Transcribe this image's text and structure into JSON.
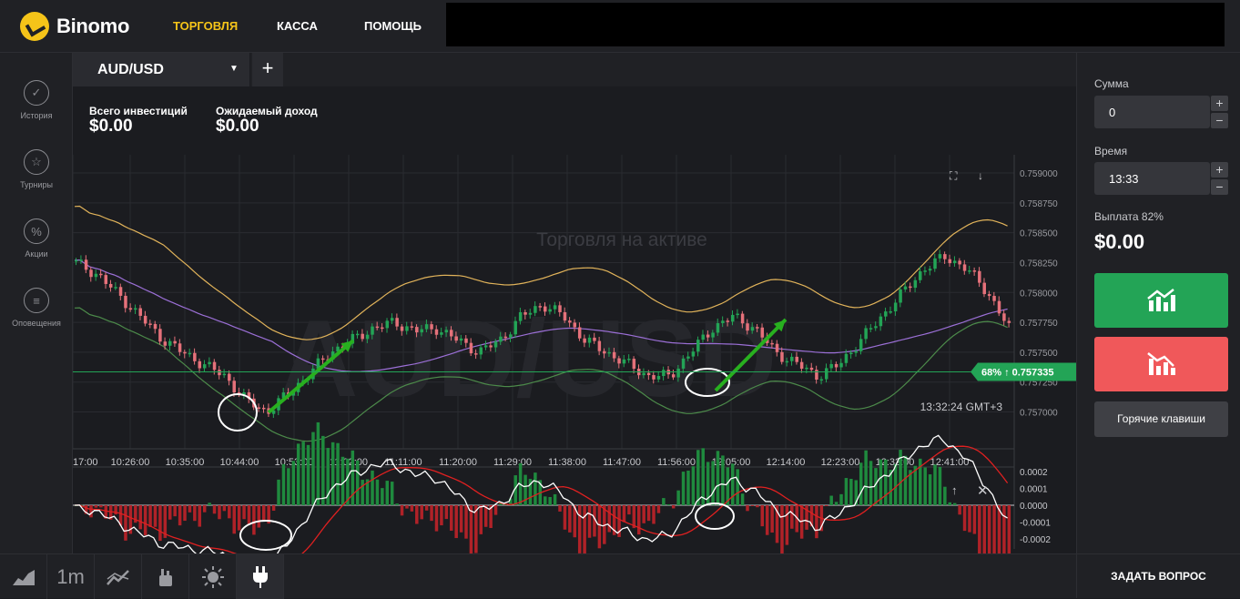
{
  "header": {
    "brand": "Binomo",
    "nav": {
      "trade": "ТОРГОВЛЯ",
      "cash": "КАССА",
      "help": "ПОМОЩЬ"
    }
  },
  "sidebar": {
    "items": [
      {
        "label": "История",
        "icon": "check-circle-icon"
      },
      {
        "label": "Турниры",
        "icon": "trophy-icon"
      },
      {
        "label": "Акции",
        "icon": "percent-icon"
      },
      {
        "label": "Оповещения",
        "icon": "menu-lines-icon"
      }
    ]
  },
  "tabs": {
    "asset": "AUD/USD",
    "add": "+"
  },
  "stats": {
    "invest_label": "Всего инвестиций",
    "invest_value": "$0.00",
    "income_label": "Ожидаемый доход",
    "income_value": "$0.00"
  },
  "chart": {
    "watermark": "AUD/USD",
    "subtitle": "Торговля на активе",
    "price_levels": [
      "0.759000",
      "0.758750",
      "0.758500",
      "0.758250",
      "0.758000",
      "0.757750",
      "0.757500",
      "0.757250",
      "0.757000"
    ],
    "time_ticks": [
      "17:00",
      "10:26:00",
      "10:35:00",
      "10:44:00",
      "10:53:00",
      "11:02:00",
      "11:11:00",
      "11:20:00",
      "11:29:00",
      "11:38:00",
      "11:47:00",
      "11:56:00",
      "12:05:00",
      "12:14:00",
      "12:23:00",
      "12:32:00",
      "12:41:00"
    ],
    "current_badge_pct": "68%",
    "current_badge_arrow": "↑",
    "current_price": "0.757335",
    "clock": "13:32:24 GMT+3",
    "osc_levels": [
      "0.0002",
      "0.0001",
      "0.0000",
      "-0.0001",
      "-0.0002"
    ],
    "colors": {
      "up": "#23a456",
      "down": "#e5717a",
      "upper_band": "#e1b35a",
      "mid_band": "#9b6fd6",
      "lower_band": "#4c8a4a",
      "macd": "#ffffff",
      "signal": "#e02020",
      "arrow": "#28b01f"
    }
  },
  "chart_data": {
    "type": "candlestick",
    "title": "AUD/USD",
    "ylim": [
      0.75692,
      0.759
    ],
    "x_ticks": [
      "10:26:00",
      "10:35:00",
      "10:44:00",
      "10:53:00",
      "11:02:00",
      "11:11:00",
      "11:20:00",
      "11:29:00",
      "11:38:00",
      "11:47:00",
      "11:56:00",
      "12:05:00",
      "12:14:00",
      "12:23:00",
      "12:32:00",
      "12:41:00"
    ],
    "close_path": [
      0.75825,
      0.75815,
      0.75798,
      0.7578,
      0.75762,
      0.7575,
      0.7574,
      0.7573,
      0.7571,
      0.757,
      0.75715,
      0.75732,
      0.7575,
      0.7576,
      0.7577,
      0.75775,
      0.75768,
      0.7577,
      0.7576,
      0.7575,
      0.7576,
      0.7578,
      0.7579,
      0.7578,
      0.7576,
      0.7575,
      0.7574,
      0.7573,
      0.7573,
      0.7575,
      0.7577,
      0.7578,
      0.7577,
      0.7575,
      0.7574,
      0.7573,
      0.7574,
      0.7576,
      0.7578,
      0.758,
      0.7582,
      0.7583,
      0.7582,
      0.758,
      0.7577
    ],
    "last_price": 0.757335,
    "grid": true
  },
  "panel": {
    "sum_label": "Сумма",
    "sum_value": "0",
    "time_label": "Время",
    "time_value": "13:33",
    "payout_label": "Выплата 82%",
    "payout_value": "$0.00",
    "hotkeys": "Горячие клавиши",
    "plus": "+",
    "minus": "−"
  },
  "bottom": {
    "timeframe": "1m",
    "ask": "ЗАДАТЬ ВОПРОС"
  }
}
